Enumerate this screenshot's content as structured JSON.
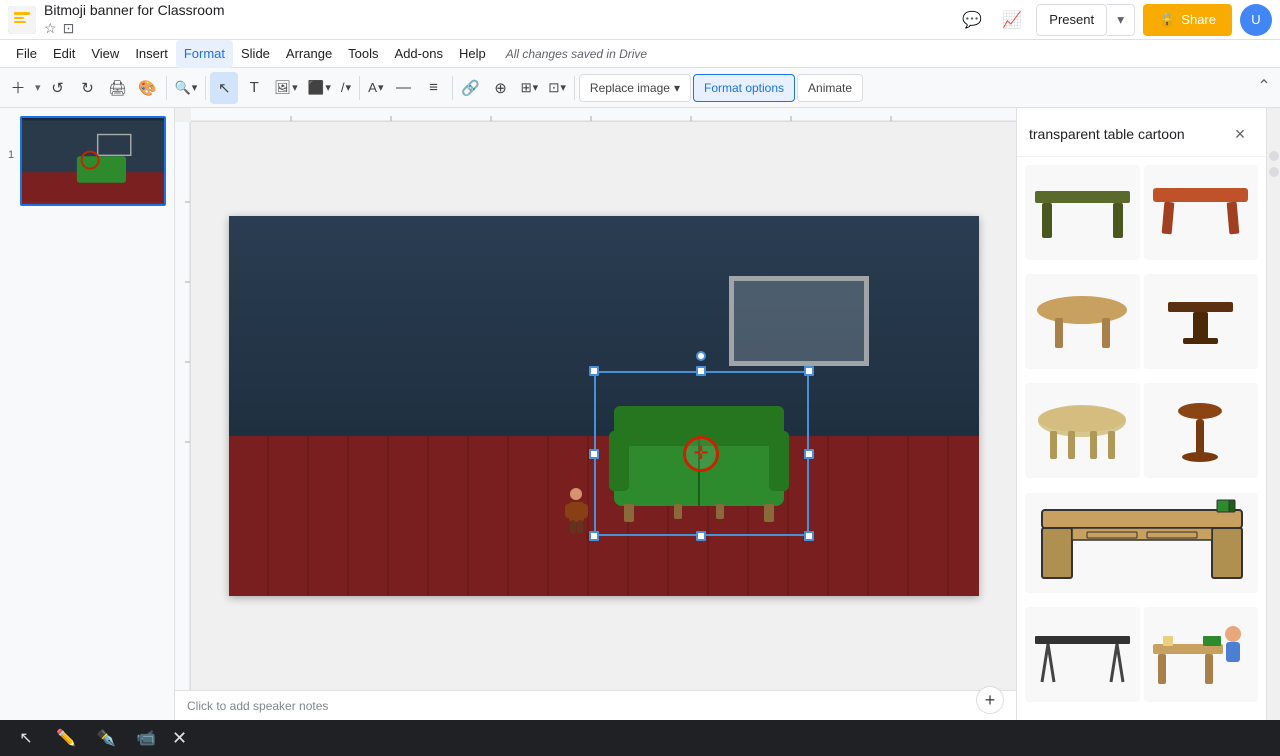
{
  "app": {
    "logo_alt": "Google Slides logo"
  },
  "document": {
    "title": "Bitmoji banner for Classroom",
    "autosave": "All changes saved in Drive"
  },
  "header": {
    "present_label": "Present",
    "share_label": "Share",
    "avatar_initials": "U"
  },
  "menu": {
    "items": [
      "File",
      "Edit",
      "View",
      "Insert",
      "Format",
      "Slide",
      "Arrange",
      "Tools",
      "Add-ons",
      "Help"
    ]
  },
  "toolbar": {
    "replace_image_label": "Replace image",
    "format_options_label": "Format options",
    "animate_label": "Animate"
  },
  "slide_panel": {
    "slide_number": "1"
  },
  "canvas": {
    "speaker_notes_placeholder": "Click to add speaker notes"
  },
  "search_panel": {
    "title": "transparent table cartoon",
    "close_label": "×"
  },
  "tables": [
    {
      "id": 1,
      "color": "#5a6a2a",
      "type": "dark-green-table"
    },
    {
      "id": 2,
      "color": "#c0522a",
      "type": "orange-wood-table"
    },
    {
      "id": 3,
      "color": "#c8a060",
      "type": "oval-tan-table"
    },
    {
      "id": 4,
      "color": "#5a3010",
      "type": "dark-brown-table"
    },
    {
      "id": 5,
      "color": "#d4b878",
      "type": "round-light-table"
    },
    {
      "id": 6,
      "color": "#8b4513",
      "type": "pedestal-table"
    },
    {
      "id": 7,
      "color": "#c8a060",
      "type": "cartoon-desk"
    },
    {
      "id": 8,
      "color": "#888",
      "type": "modern-table"
    },
    {
      "id": 9,
      "color": "#c8a060",
      "type": "side-table"
    }
  ],
  "bottom_toolbar": {
    "tools": [
      "cursor",
      "pencil",
      "pen",
      "video",
      "close"
    ]
  }
}
